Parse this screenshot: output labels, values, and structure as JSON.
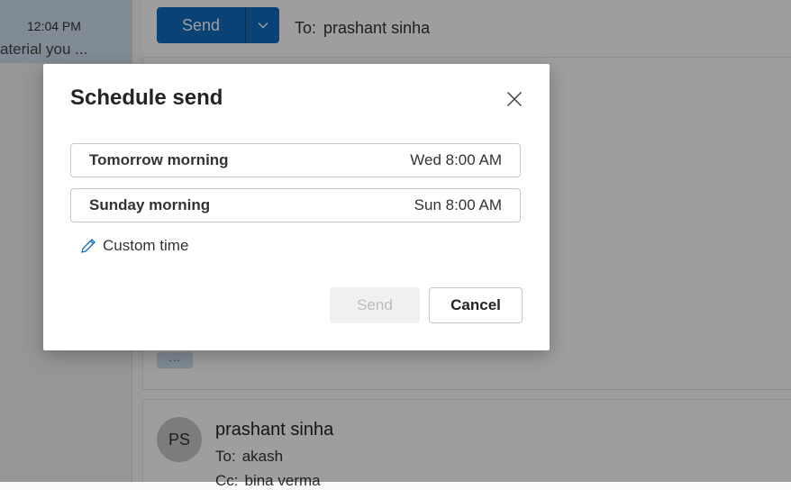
{
  "message_list": {
    "time": "12:04 PM",
    "snippet": "aterial you ..."
  },
  "compose": {
    "send_label": "Send",
    "to_label": "To:",
    "to_value": "prashant sinha",
    "more_label": "..."
  },
  "thread": {
    "avatar_initials": "PS",
    "sender": "prashant sinha",
    "to_label": "To:",
    "to_value": "akash",
    "cc_label": "Cc:",
    "cc_value": "bina verma"
  },
  "dialog": {
    "title": "Schedule send",
    "options": [
      {
        "label": "Tomorrow morning",
        "time": "Wed 8:00 AM"
      },
      {
        "label": "Sunday morning",
        "time": "Sun 8:00 AM"
      }
    ],
    "custom_time_label": "Custom time",
    "send_label": "Send",
    "cancel_label": "Cancel"
  },
  "colors": {
    "accent": "#0f6cbd",
    "overlay": "#000000",
    "disabled_bg": "#f0f0f0"
  },
  "icons": {
    "dropdown": "chevron-down-icon",
    "close": "close-icon",
    "custom_time": "pencil-icon"
  }
}
